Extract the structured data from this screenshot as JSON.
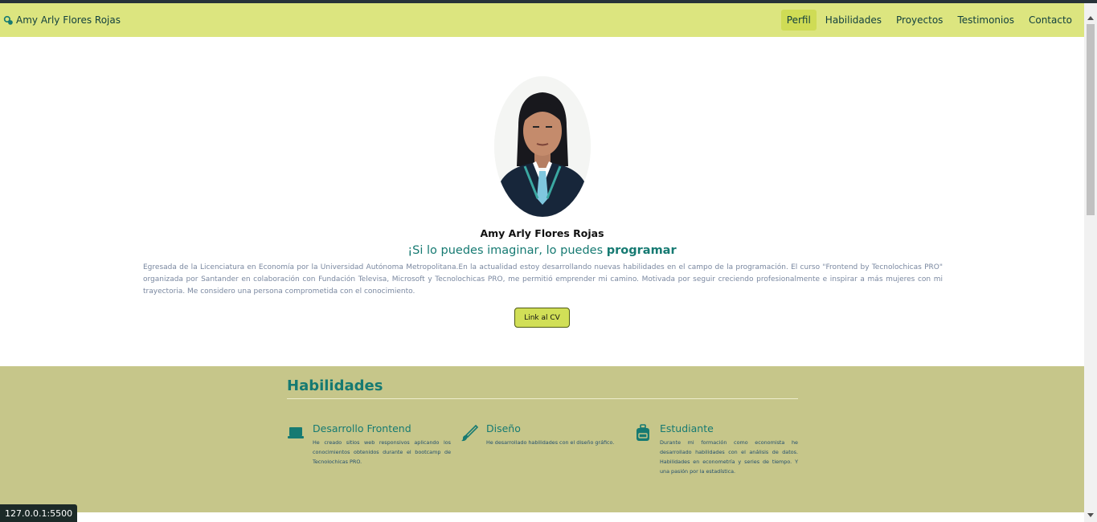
{
  "navbar": {
    "brand_icon": "leaf-icon",
    "brand": "Amy Arly Flores Rojas",
    "links": [
      "Perfil",
      "Habilidades",
      "Proyectos",
      "Testimonios",
      "Contacto"
    ],
    "active_link": "Perfil"
  },
  "hero": {
    "photo": "profile-photo",
    "name": "Amy Arly Flores Rojas",
    "tagline_part1": "¡Si lo puedes imaginar, lo puedes ",
    "tagline_part2": "programar",
    "bio": "Egresada de la Licenciatura en Economía por la Universidad Autónoma Metropolitana.En la actualidad estoy desarrollando nuevas habilidades en el campo de la programación. El curso \"Frontend by Tecnolochicas PRO\" organizada por Santander en colaboración con Fundación Televisa, Microsoft y Tecnolochicas PRO, me permitió emprender mi camino. Motivada por seguir creciendo profesionalmente e inspirar a más mujeres con mi trayectoria. Me considero una persona comprometida con el conocimiento.",
    "cv_button": "Link al CV"
  },
  "skills": {
    "title": "Habilidades",
    "items": [
      {
        "icon": "laptop-icon",
        "title": "Desarrollo Frontend",
        "text": "He creado sitios web responsivos aplicando los conocimientos obtenidos durante el bootcamp de Tecnolochicas PRO."
      },
      {
        "icon": "brush-icon",
        "title": "Diseño",
        "text": "He desarrollado habilidades con el diseño gráfico."
      },
      {
        "icon": "briefcase-icon",
        "title": "Estudiante",
        "text": "Durante mi formación como economista he desarrollado habilidades con el análisis de datos. Habilidades en econometría y series de tiempo. Y una pasión por la estadística."
      }
    ]
  },
  "status_url": "127.0.0.1:5500",
  "colors": {
    "navbar": "#dce57f",
    "accent": "#167a72",
    "skills_bg": "#c6c68a",
    "button": "#d1df57"
  }
}
